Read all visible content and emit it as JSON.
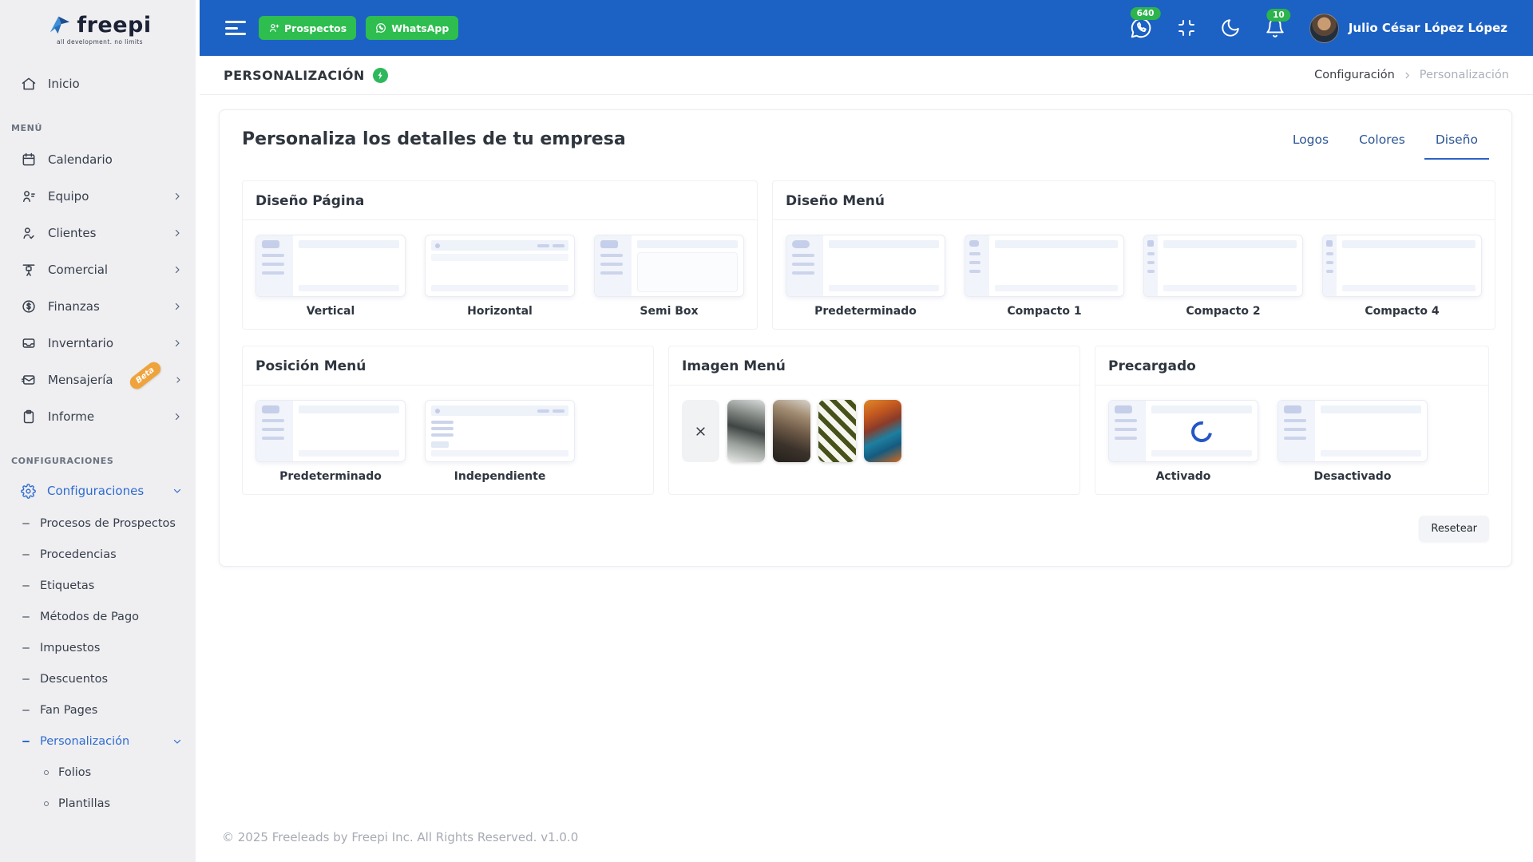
{
  "colors": {
    "topbar_blue": "#1c61c4",
    "action_green": "#2ebd4f",
    "badge_green": "#2db44d",
    "accent_blue": "#2e6bd0",
    "tab_underline_blue": "#2b63c5",
    "beta_orange": "#efa33d",
    "sidebar_bg": "#efeff1"
  },
  "brand": {
    "name": "freepi",
    "tagline": "all development. no limits"
  },
  "topbar": {
    "prospects_button": "Prospectos",
    "whatsapp_button": "WhatsApp",
    "calls_badge": "640",
    "notifications_badge": "10",
    "user_name": "Julio César López López"
  },
  "sidebar": {
    "home_label": "Inicio",
    "menu_section_label": "MENÚ",
    "menu": [
      {
        "label": "Calendario"
      },
      {
        "label": "Equipo"
      },
      {
        "label": "Clientes"
      },
      {
        "label": "Comercial"
      },
      {
        "label": "Finanzas"
      },
      {
        "label": "Inverntario"
      },
      {
        "label": "Mensajería",
        "badge": "Beta"
      },
      {
        "label": "Informe"
      }
    ],
    "config_section_label": "CONFIGURACIONES",
    "config_root_label": "Configuraciones",
    "config_items": [
      {
        "label": "Procesos de Prospectos"
      },
      {
        "label": "Procedencias"
      },
      {
        "label": "Etiquetas"
      },
      {
        "label": "Métodos de Pago"
      },
      {
        "label": "Impuestos"
      },
      {
        "label": "Descuentos"
      },
      {
        "label": "Fan Pages"
      },
      {
        "label": "Personalización"
      }
    ],
    "personalizacion_children": [
      {
        "label": "Folios"
      },
      {
        "label": "Plantillas"
      }
    ]
  },
  "page_header": {
    "title": "PERSONALIZACIÓN",
    "breadcrumb_parent": "Configuración",
    "breadcrumb_current": "Personalización"
  },
  "card": {
    "title": "Personaliza los detalles de tu empresa",
    "tabs": [
      {
        "label": "Logos"
      },
      {
        "label": "Colores"
      },
      {
        "label": "Diseño"
      }
    ],
    "active_tab": "Diseño",
    "sections": {
      "diseno_pagina": {
        "title": "Diseño Página",
        "options": [
          {
            "label": "Vertical"
          },
          {
            "label": "Horizontal"
          },
          {
            "label": "Semi Box"
          }
        ]
      },
      "diseno_menu": {
        "title": "Diseño Menú",
        "options": [
          {
            "label": "Predeterminado"
          },
          {
            "label": "Compacto 1"
          },
          {
            "label": "Compacto 2"
          },
          {
            "label": "Compacto 4"
          }
        ]
      },
      "posicion_menu": {
        "title": "Posición Menú",
        "options": [
          {
            "label": "Predeterminado"
          },
          {
            "label": "Independiente"
          }
        ]
      },
      "imagen_menu": {
        "title": "Imagen Menú",
        "images": [
          {
            "name": "snow-forest-photo"
          },
          {
            "name": "workshop-photo"
          },
          {
            "name": "green-chevron-pattern"
          },
          {
            "name": "colorful-abstract-photo"
          }
        ]
      },
      "precargado": {
        "title": "Precargado",
        "options": [
          {
            "label": "Activado"
          },
          {
            "label": "Desactivado"
          }
        ]
      }
    },
    "reset_button": "Resetear"
  },
  "footer": {
    "copyright": "© 2025 Freeleads by Freepi Inc. All Rights Reserved. v1.0.0"
  }
}
